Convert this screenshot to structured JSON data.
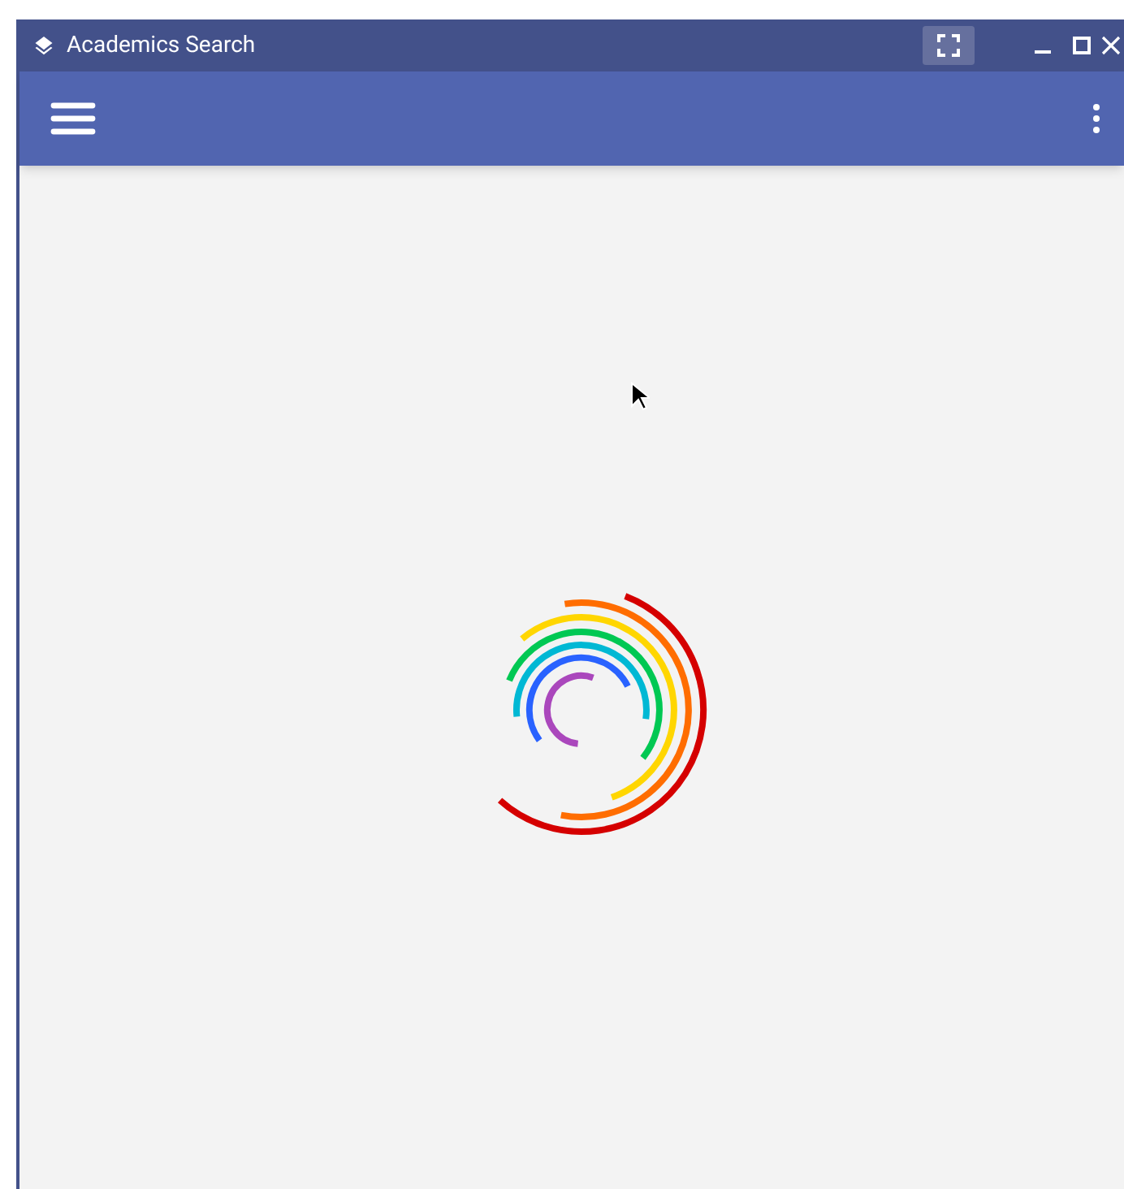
{
  "window": {
    "title": "Academics Search"
  }
}
